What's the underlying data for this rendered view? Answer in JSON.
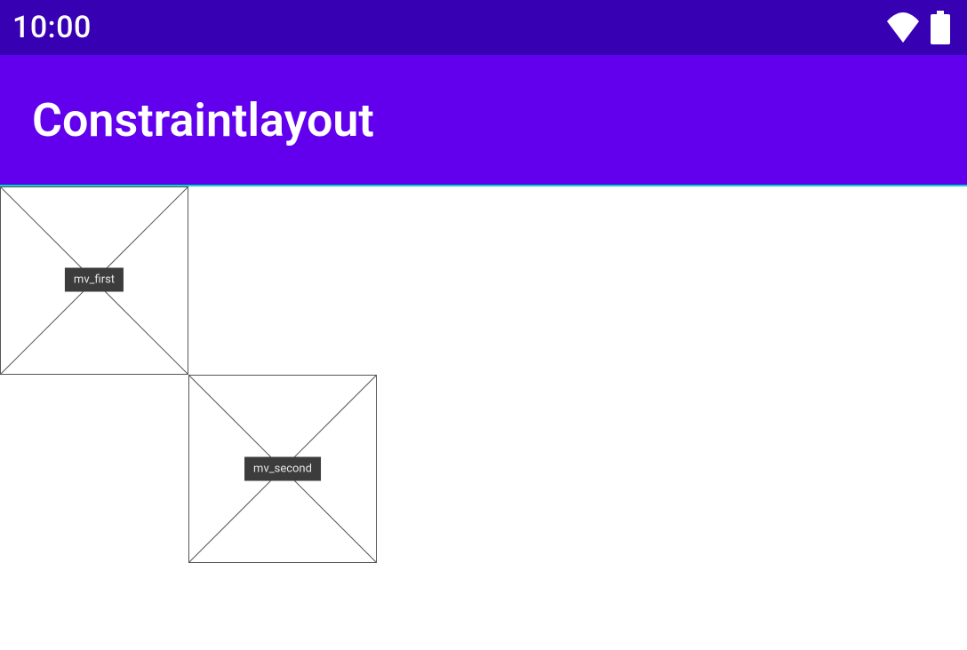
{
  "status": {
    "time": "10:00"
  },
  "appbar": {
    "title": "Constraintlayout"
  },
  "views": {
    "first": {
      "label": "mv_first"
    },
    "second": {
      "label": "mv_second"
    }
  }
}
